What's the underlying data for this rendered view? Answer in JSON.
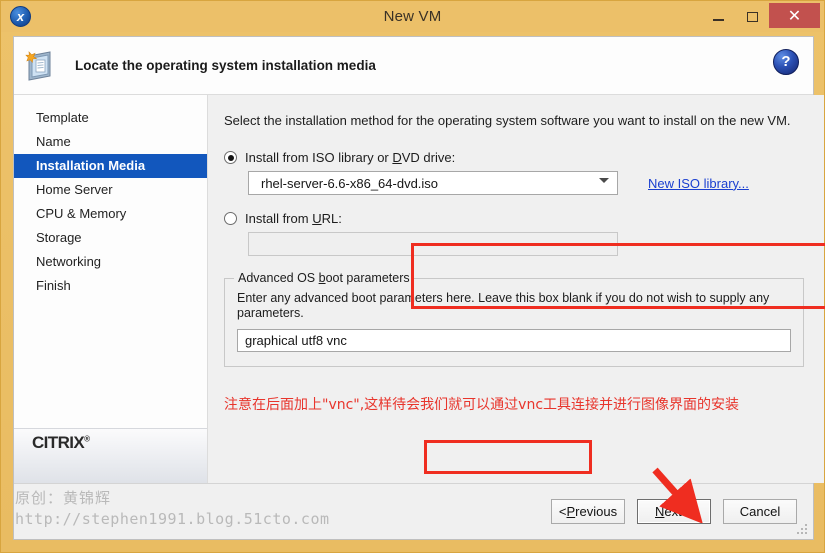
{
  "window": {
    "title": "New VM",
    "app_icon": "xencenter-x-icon",
    "controls": {
      "minimize": "minimize-icon",
      "maximize": "maximize-icon",
      "close": "✕"
    }
  },
  "banner": {
    "title": "Locate the operating system installation media",
    "icon": "new-vm-icon",
    "help": "?"
  },
  "sidebar": {
    "items": [
      {
        "label": "Template",
        "active": false
      },
      {
        "label": "Name",
        "active": false
      },
      {
        "label": "Installation Media",
        "active": true
      },
      {
        "label": "Home Server",
        "active": false
      },
      {
        "label": "CPU & Memory",
        "active": false
      },
      {
        "label": "Storage",
        "active": false
      },
      {
        "label": "Networking",
        "active": false
      },
      {
        "label": "Finish",
        "active": false
      }
    ],
    "logo": "CITRIX",
    "logo_trademark": "®"
  },
  "content": {
    "intro": "Select the installation method for the operating system software you want to install on the new VM.",
    "iso_option": {
      "label_pre": "Install from ISO library or ",
      "label_mnemonic": "D",
      "label_post": "VD drive:",
      "selected": true,
      "value": "rhel-server-6.6-x86_64-dvd.iso",
      "link": "New ISO library..."
    },
    "url_option": {
      "label_pre": "Install from ",
      "label_mnemonic": "U",
      "label_post": "RL:",
      "selected": false,
      "value": "",
      "placeholder": ""
    },
    "boot_group": {
      "legend_pre": "Advanced OS ",
      "legend_mnemonic": "b",
      "legend_post": "oot parameters",
      "description": "Enter any advanced boot parameters here. Leave this box blank if you do not wish to supply any parameters.",
      "value": "graphical utf8 vnc",
      "placeholder": ""
    },
    "annotation": "注意在后面加上\"vnc\",这样待会我们就可以通过vnc工具连接并进行图像界面的安装"
  },
  "footer": {
    "previous_pre": "< ",
    "previous_mnemonic": "P",
    "previous_post": "revious",
    "next_mnemonic": "N",
    "next_post": "ext >",
    "cancel": "Cancel"
  },
  "watermark": {
    "line1": "原创：黄锦辉",
    "line2": "http://stephen1991.blog.51cto.com"
  },
  "colors": {
    "titlebar": "#ecc069",
    "accent": "#1257bd",
    "highlight": "#ef2d20",
    "link": "#1a3fd0",
    "close_button": "#c2514e"
  }
}
